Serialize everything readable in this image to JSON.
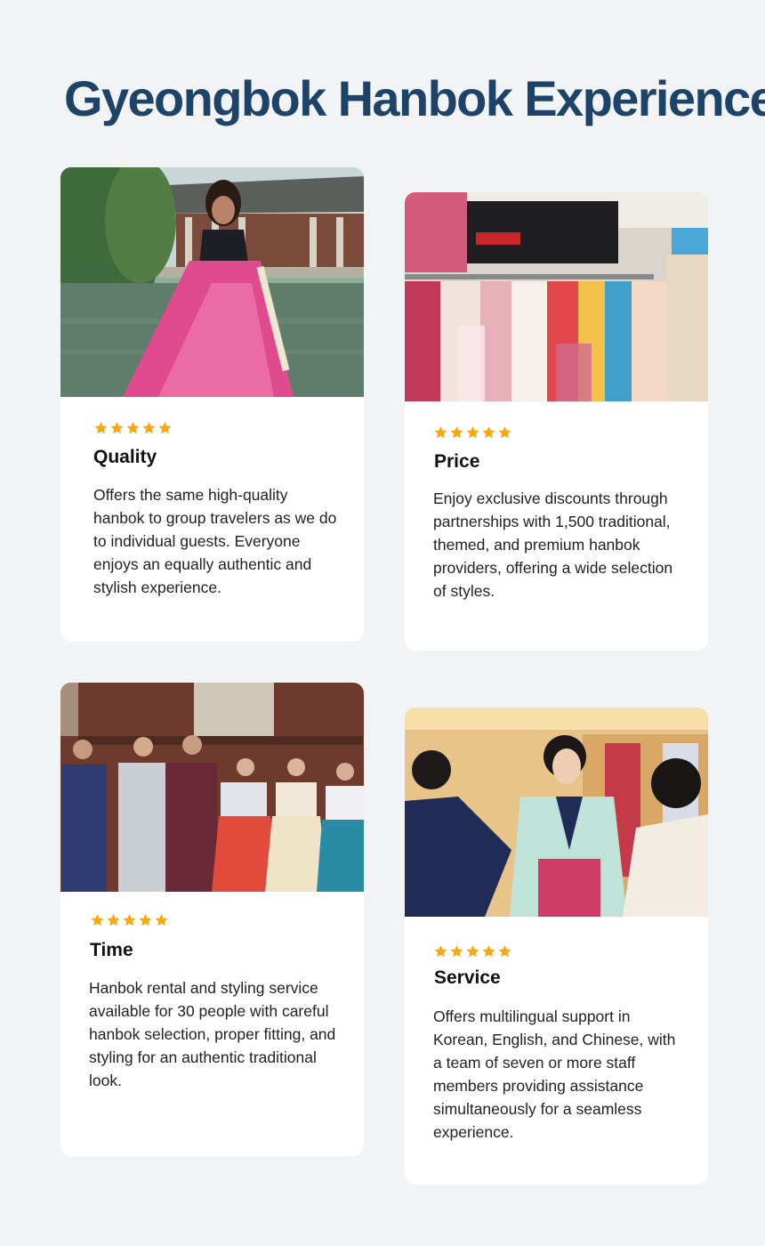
{
  "page": {
    "title": "Gyeongbok Hanbok Experience",
    "accent_color": "#1d4468",
    "star_color": "#f5a914",
    "background_color": "#f1f3f5"
  },
  "cards": [
    {
      "title": "Quality",
      "rating": 5,
      "image": "woman-in-pink-hanbok-at-palace-pavilion",
      "description": "Offers the same high-quality hanbok to group travelers as we do to individual guests. Everyone enjoys an equally authentic and stylish experience."
    },
    {
      "title": "Price",
      "rating": 5,
      "image": "hanbok-rental-shop-clothing-racks",
      "description": "Enjoy exclusive discounts through partnerships with 1,500 traditional, themed, and premium hanbok providers, offering a wide selection of styles."
    },
    {
      "title": "Time",
      "rating": 5,
      "image": "group-of-six-in-royal-hanbok",
      "description": "Hanbok rental and styling service available for 30 people with careful hanbok selection, proper fitting, and styling for an authentic traditional look."
    },
    {
      "title": "Service",
      "rating": 5,
      "image": "staff-fitting-hanbok-on-customer",
      "description": "Offers multilingual support in Korean, English, and Chinese, with a team of seven or more staff members providing assistance simultaneously for a seamless experience."
    }
  ]
}
